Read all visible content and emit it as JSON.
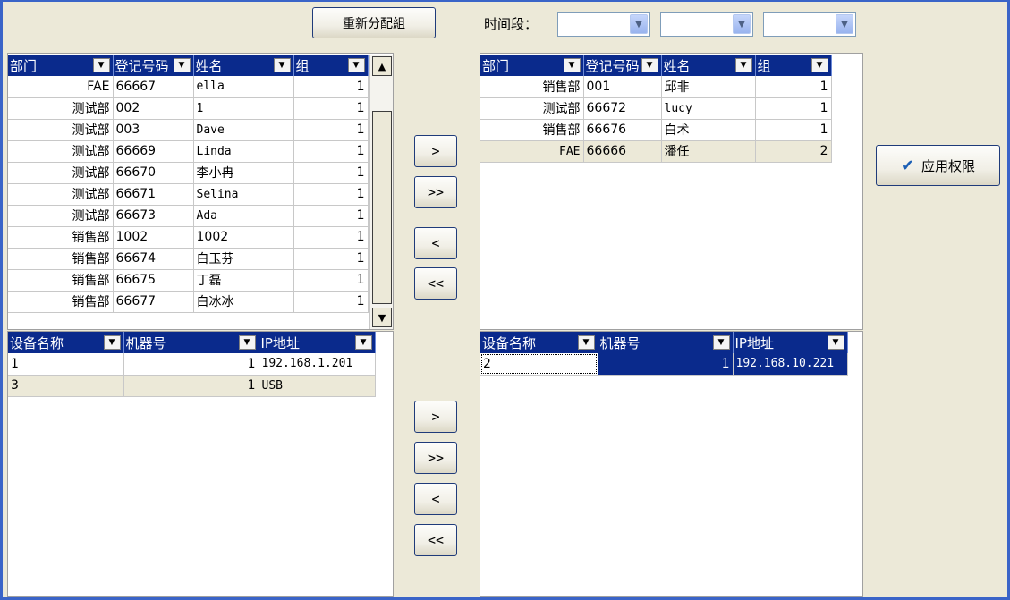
{
  "toolbar": {
    "regroup_label": "重新分配組",
    "time_period_label": "时间段：",
    "combos": [
      "",
      "",
      ""
    ]
  },
  "left_users": {
    "headers": [
      "部门",
      "登记号码",
      "姓名",
      "组"
    ],
    "rows": [
      [
        "FAE",
        "66667",
        "ella",
        "1"
      ],
      [
        "测试部",
        "002",
        "1",
        "1"
      ],
      [
        "测试部",
        "003",
        "Dave",
        "1"
      ],
      [
        "测试部",
        "66669",
        "Linda",
        "1"
      ],
      [
        "测试部",
        "66670",
        "李小冉",
        "1"
      ],
      [
        "测试部",
        "66671",
        "Selina",
        "1"
      ],
      [
        "测试部",
        "66673",
        "Ada",
        "1"
      ],
      [
        "销售部",
        "1002",
        "1002",
        "1"
      ],
      [
        "销售部",
        "66674",
        "白玉芬",
        "1"
      ],
      [
        "销售部",
        "66675",
        "丁磊",
        "1"
      ],
      [
        "销售部",
        "66677",
        "白冰冰",
        "1"
      ]
    ]
  },
  "right_users": {
    "headers": [
      "部门",
      "登记号码",
      "姓名",
      "组"
    ],
    "rows": [
      [
        "销售部",
        "001",
        "邱非",
        "1"
      ],
      [
        "测试部",
        "66672",
        "lucy",
        "1"
      ],
      [
        "销售部",
        "66676",
        "白术",
        "1"
      ],
      [
        "FAE",
        "66666",
        "潘任",
        "2"
      ]
    ]
  },
  "left_devices": {
    "headers": [
      "设备名称",
      "机器号",
      "IP地址"
    ],
    "rows": [
      [
        "1",
        "1",
        "192.168.1.201"
      ],
      [
        "3",
        "1",
        "USB"
      ]
    ]
  },
  "right_devices": {
    "headers": [
      "设备名称",
      "机器号",
      "IP地址"
    ],
    "rows": [
      [
        "2",
        "1",
        "192.168.10.221"
      ]
    ]
  },
  "transfer_buttons": {
    "add": ">",
    "add_all": ">>",
    "remove": "<",
    "remove_all": "<<"
  },
  "apply_button": {
    "label": "应用权限",
    "icon": "check-icon"
  }
}
